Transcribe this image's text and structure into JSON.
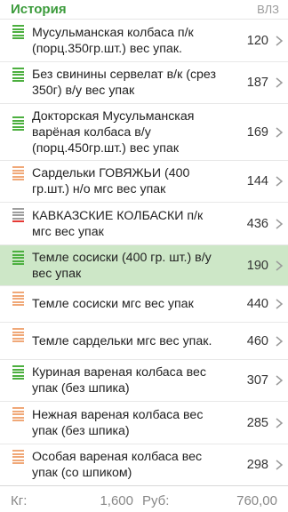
{
  "header": {
    "title": "История",
    "column_label": "ВЛЗ"
  },
  "colors": {
    "green": "#4caf3f",
    "orange": "#f0a878",
    "red": "#e53935",
    "gray": "#9e9e9e",
    "selected_bg": "#cde7c7"
  },
  "items": [
    {
      "name": "Мусульманская колбаса п/к (порц.350гр.шт.) вес упак.",
      "qty": "120",
      "indicator": "green",
      "selected": false
    },
    {
      "name": "Без свинины сервелат в/к (срез 350г) в/у вес упак",
      "qty": "187",
      "indicator": "green",
      "selected": false
    },
    {
      "name": "Докторская Мусульманская варёная колбаса в/у (порц.450гр.шт.) вес упак",
      "qty": "169",
      "indicator": "green",
      "selected": false
    },
    {
      "name": "Сардельки ГОВЯЖЬИ (400 гр.шт.) н/о мгс вес упак",
      "qty": "144",
      "indicator": "orange",
      "selected": false
    },
    {
      "name": "КАВКАЗСКИЕ КОЛБАСКИ п/к мгс вес упак",
      "qty": "436",
      "indicator": "red",
      "selected": false
    },
    {
      "name": "Темле сосиски (400 гр. шт.) в/у вес упак",
      "qty": "190",
      "indicator": "green",
      "selected": true
    },
    {
      "name": "Темле сосиски мгс вес упак",
      "qty": "440",
      "indicator": "orange",
      "selected": false
    },
    {
      "name": "Темле сардельки мгс вес упак.",
      "qty": "460",
      "indicator": "orange",
      "selected": false
    },
    {
      "name": "Куриная вареная колбаса вес упак (без шпика)",
      "qty": "307",
      "indicator": "green",
      "selected": false
    },
    {
      "name": "Нежная вареная колбаса вес упак (без шпика)",
      "qty": "285",
      "indicator": "orange",
      "selected": false
    },
    {
      "name": "Особая вареная колбаса вес упак (со шпиком)",
      "qty": "298",
      "indicator": "orange",
      "selected": false
    }
  ],
  "footer": {
    "kg_label": "Кг:",
    "kg_value": "1,600",
    "rub_label": "Руб:",
    "rub_value": "760,00"
  }
}
